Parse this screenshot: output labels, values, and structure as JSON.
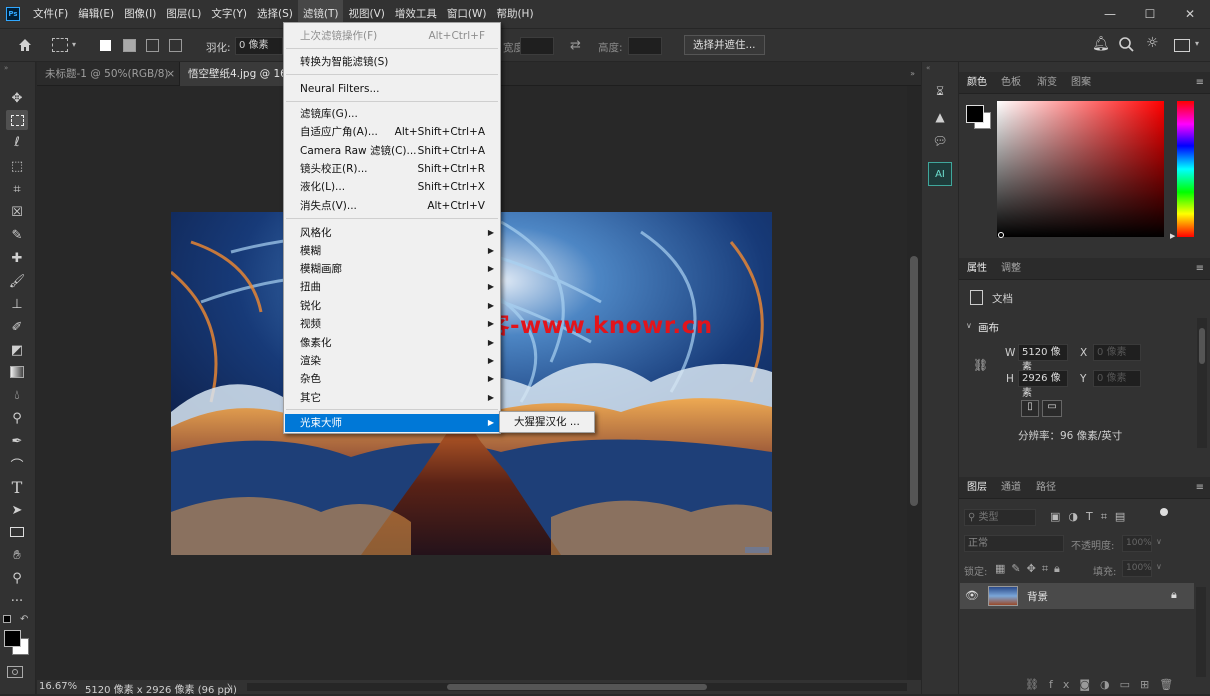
{
  "app": {
    "logo": "Ps"
  },
  "menubar": [
    "文件(F)",
    "编辑(E)",
    "图像(I)",
    "图层(L)",
    "文字(Y)",
    "选择(S)",
    "滤镜(T)",
    "视图(V)",
    "增效工具",
    "窗口(W)",
    "帮助(H)"
  ],
  "window_controls": {
    "minimize": "—",
    "maximize": "☐",
    "close": "✕"
  },
  "options_bar": {
    "feather_label": "羽化:",
    "feather_value": "0 像素",
    "width_label": "宽度:",
    "height_label": "高度:",
    "select_mask_button": "选择并遮住..."
  },
  "tabs": [
    "未标题-1 @ 50%(RGB/8)",
    "悟空壁纸4.jpg @ 16.7%(RGB/8)"
  ],
  "status_bar": {
    "zoom": "16.67%",
    "doc_info": "5120 像素 x 2926 像素 (96 ppi)",
    "arrow": "〉"
  },
  "watermark": "知软博客-www.knowr.cn",
  "filter_menu": {
    "items": [
      {
        "label": "上次滤镜操作(F)",
        "shortcut": "Alt+Ctrl+F",
        "disabled": true
      },
      {
        "label": "转换为智能滤镜(S)"
      },
      {
        "label": "Neural Filters..."
      },
      {
        "label": "滤镜库(G)..."
      },
      {
        "label": "自适应广角(A)...",
        "shortcut": "Alt+Shift+Ctrl+A"
      },
      {
        "label": "Camera Raw 滤镜(C)...",
        "shortcut": "Shift+Ctrl+A"
      },
      {
        "label": "镜头校正(R)...",
        "shortcut": "Shift+Ctrl+R"
      },
      {
        "label": "液化(L)...",
        "shortcut": "Shift+Ctrl+X"
      },
      {
        "label": "消失点(V)...",
        "shortcut": "Alt+Ctrl+V"
      },
      {
        "label": "风格化"
      },
      {
        "label": "模糊"
      },
      {
        "label": "模糊画廊"
      },
      {
        "label": "扭曲"
      },
      {
        "label": "锐化"
      },
      {
        "label": "视频"
      },
      {
        "label": "像素化"
      },
      {
        "label": "渲染"
      },
      {
        "label": "杂色"
      },
      {
        "label": "其它"
      },
      {
        "label": "光束大师",
        "selected": true
      }
    ],
    "submenu_item": "大猩猩汉化 ..."
  },
  "color_panel": {
    "tabs": [
      "颜色",
      "色板",
      "渐变",
      "图案"
    ]
  },
  "properties_panel": {
    "tabs": [
      "属性",
      "调整"
    ],
    "doc_label": "文档",
    "canvas_section": "画布",
    "w_label": "W",
    "w_value": "5120 像素",
    "h_label": "H",
    "h_value": "2926 像素",
    "x_label": "X",
    "x_placeholder": "0 像素",
    "y_label": "Y",
    "y_placeholder": "0 像素",
    "resolution": "分辨率：96 像素/英寸"
  },
  "layers_panel": {
    "tabs": [
      "图层",
      "通道",
      "路径"
    ],
    "filter_kind": "类型",
    "blend_mode": "正常",
    "opacity_label": "不透明度:",
    "opacity_value": "100%",
    "lock_label": "锁定:",
    "fill_label": "填充:",
    "fill_value": "100%",
    "layer_name": "背景"
  },
  "colors": {
    "accent": "#0078d7",
    "watermark": "#e3141b",
    "fg": "#000000",
    "bg": "#ffffff"
  }
}
